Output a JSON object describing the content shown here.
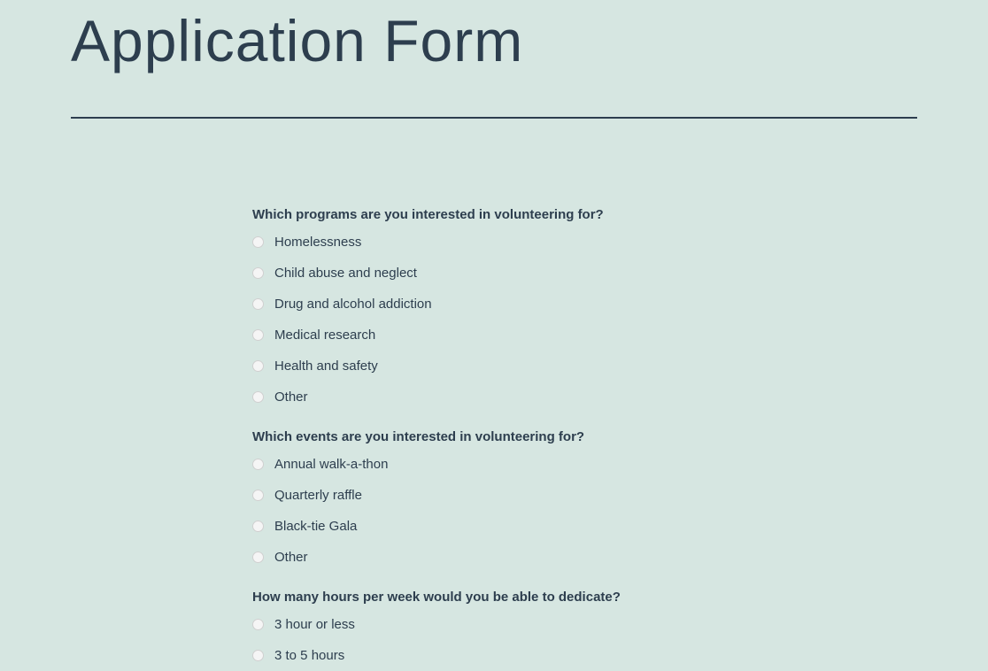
{
  "title": "Application Form",
  "questions": [
    {
      "text": "Which programs are you interested in volunteering for?",
      "options": [
        "Homelessness",
        "Child abuse and neglect",
        "Drug and alcohol addiction",
        "Medical research",
        "Health and safety",
        "Other"
      ]
    },
    {
      "text": "Which events are you interested in volunteering for?",
      "options": [
        "Annual walk-a-thon",
        "Quarterly raffle",
        "Black-tie Gala",
        "Other"
      ]
    },
    {
      "text": "How many hours per week would you be able to dedicate?",
      "options": [
        "3 hour or less",
        "3 to 5 hours"
      ]
    }
  ]
}
